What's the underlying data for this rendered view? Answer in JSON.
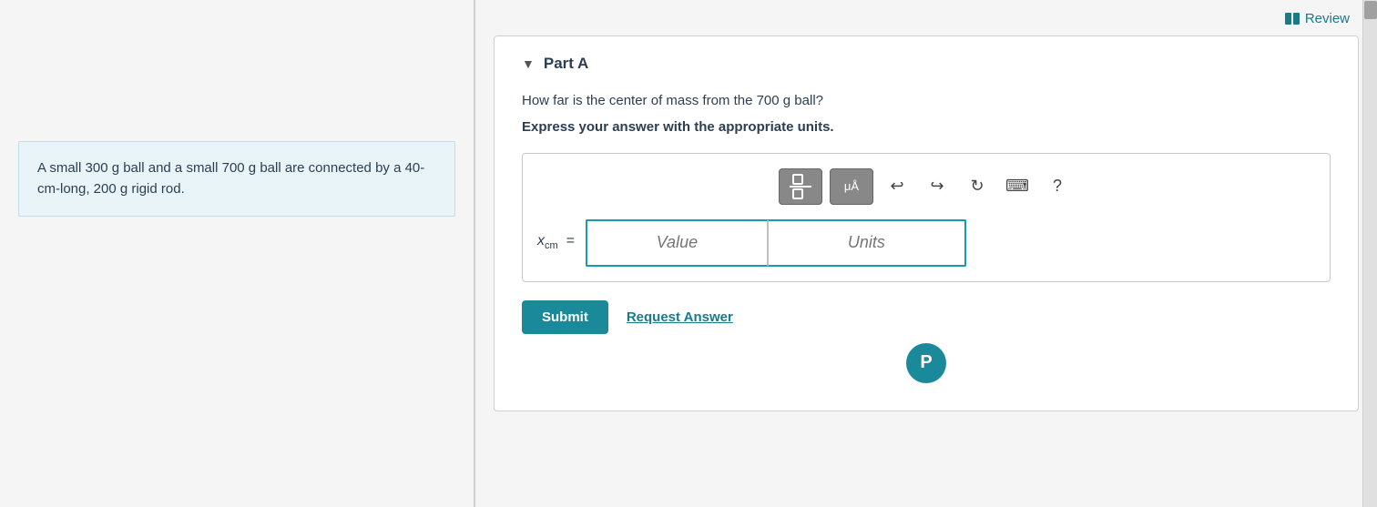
{
  "left": {
    "problem_text": "A small 300 g ball and a small 700 g ball are connected by a 40-cm-long, 200 g rigid rod."
  },
  "right": {
    "review_label": "Review",
    "part_a_label": "Part A",
    "question": "How far is the center of mass from the 700 g ball?",
    "instruction": "Express your answer with the appropriate units.",
    "toolbar": {
      "fraction_btn": "fraction",
      "units_btn": "μÅ",
      "undo_btn": "undo",
      "redo_btn": "redo",
      "refresh_btn": "refresh",
      "keyboard_btn": "keyboard",
      "help_btn": "?"
    },
    "input_label": "x",
    "input_subscript": "cm",
    "value_placeholder": "Value",
    "units_placeholder": "Units",
    "submit_label": "Submit",
    "request_answer_label": "Request Answer"
  }
}
